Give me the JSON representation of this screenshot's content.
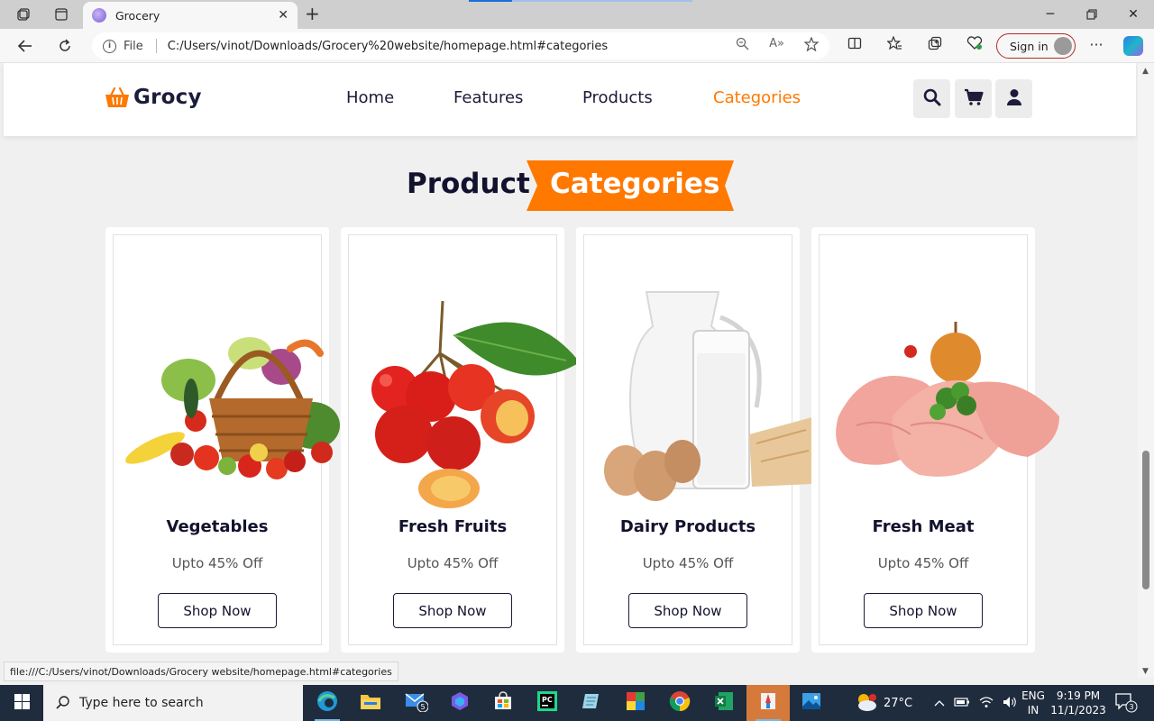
{
  "browser": {
    "tab_title": "Grocery",
    "address_protocol": "File",
    "address_url": "C:/Users/vinot/Downloads/Grocery%20website/homepage.html#categories",
    "signin_label": "Sign in",
    "status_url": "file:///C:/Users/vinot/Downloads/Grocery website/homepage.html#categories"
  },
  "site": {
    "logo_text": "Grocy",
    "nav": [
      {
        "label": "Home",
        "active": false
      },
      {
        "label": "Features",
        "active": false
      },
      {
        "label": "Products",
        "active": false
      },
      {
        "label": "Categories",
        "active": true
      }
    ],
    "accent_color": "#ff7800",
    "heading_plain": "Product",
    "heading_highlight": "Categories"
  },
  "categories": [
    {
      "title": "Vegetables",
      "subtitle": "Upto 45% Off",
      "button": "Shop Now",
      "image": "vegetable-basket-image"
    },
    {
      "title": "Fresh Fruits",
      "subtitle": "Upto 45% Off",
      "button": "Shop Now",
      "image": "cherries-image"
    },
    {
      "title": "Dairy Products",
      "subtitle": "Upto 45% Off",
      "button": "Shop Now",
      "image": "milk-eggs-image"
    },
    {
      "title": "Fresh Meat",
      "subtitle": "Upto 45% Off",
      "button": "Shop Now",
      "image": "chicken-meat-image"
    }
  ],
  "taskbar": {
    "search_placeholder": "Type here to search",
    "weather": "27°C",
    "language_line1": "ENG",
    "language_line2": "IN",
    "time": "9:19 PM",
    "date": "11/1/2023",
    "mail_badge": "5",
    "notification_badge": "3"
  }
}
